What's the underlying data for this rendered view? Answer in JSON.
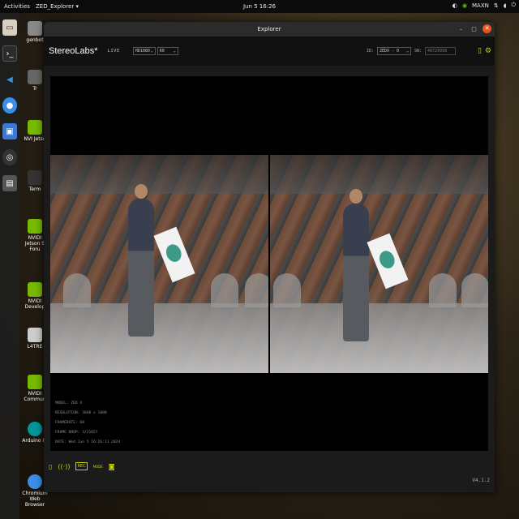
{
  "topbar": {
    "activities": "Activities",
    "app_menu": "ZED_Explorer ▾",
    "clock": "Jun 5  16:26",
    "maxn": "MAXN",
    "tray_icons": [
      "app-indicator-icon",
      "power-mode-icon",
      "network-icon",
      "volume-icon",
      "power-icon"
    ]
  },
  "dock": [
    "files-icon",
    "terminal-icon",
    "vscode-icon",
    "chromium-icon",
    "screenshot-icon",
    "obs-icon",
    "app-grid-icon"
  ],
  "desktop": {
    "icons": [
      {
        "label": "genbot",
        "icon": "home-folder-icon"
      },
      {
        "label": "Tr",
        "icon": "trash-icon"
      },
      {
        "label": "NVI Jetso",
        "icon": "nvidia-icon"
      },
      {
        "label": "Term",
        "icon": "terminal-icon"
      },
      {
        "label": "NVIDI Jetson S Foru",
        "icon": "nvidia-icon"
      },
      {
        "label": "NVIDI Develop",
        "icon": "nvidia-icon"
      },
      {
        "label": "L4TRE",
        "icon": "document-icon"
      },
      {
        "label": "NVIDI Commun",
        "icon": "nvidia-icon"
      },
      {
        "label": "Arduino ID",
        "icon": "arduino-icon"
      },
      {
        "label": "Chromium Web Browser",
        "icon": "chromium-icon"
      }
    ]
  },
  "window": {
    "title": "Explorer",
    "controls": {
      "minimize": "–",
      "maximize": "▢",
      "close": "✕"
    },
    "toolbar": {
      "brand": "StereoLabs*",
      "live": "LIVE",
      "resolution": "HD1080",
      "fps": "60",
      "id_label": "ID:",
      "camera_id": "ZEDX - 0",
      "sn_label": "SN:",
      "sn_value": "40729998"
    },
    "metadata": {
      "model": "MODEL: ZED X",
      "resolution": "RESOLUTION: 3840 x 1080",
      "framerate": "FRAMERATE: 60",
      "frame_drop": "FRAME DROP: 3/21657",
      "date": "DATE: Wed Jun 5 16:26:11 2024"
    },
    "bottom": {
      "rec_badge": "REC",
      "mode": "MODE",
      "version": "V4.1.2"
    }
  },
  "colors": {
    "accent": "#c8d000",
    "close": "#e95420",
    "nvidia": "#76b900"
  }
}
